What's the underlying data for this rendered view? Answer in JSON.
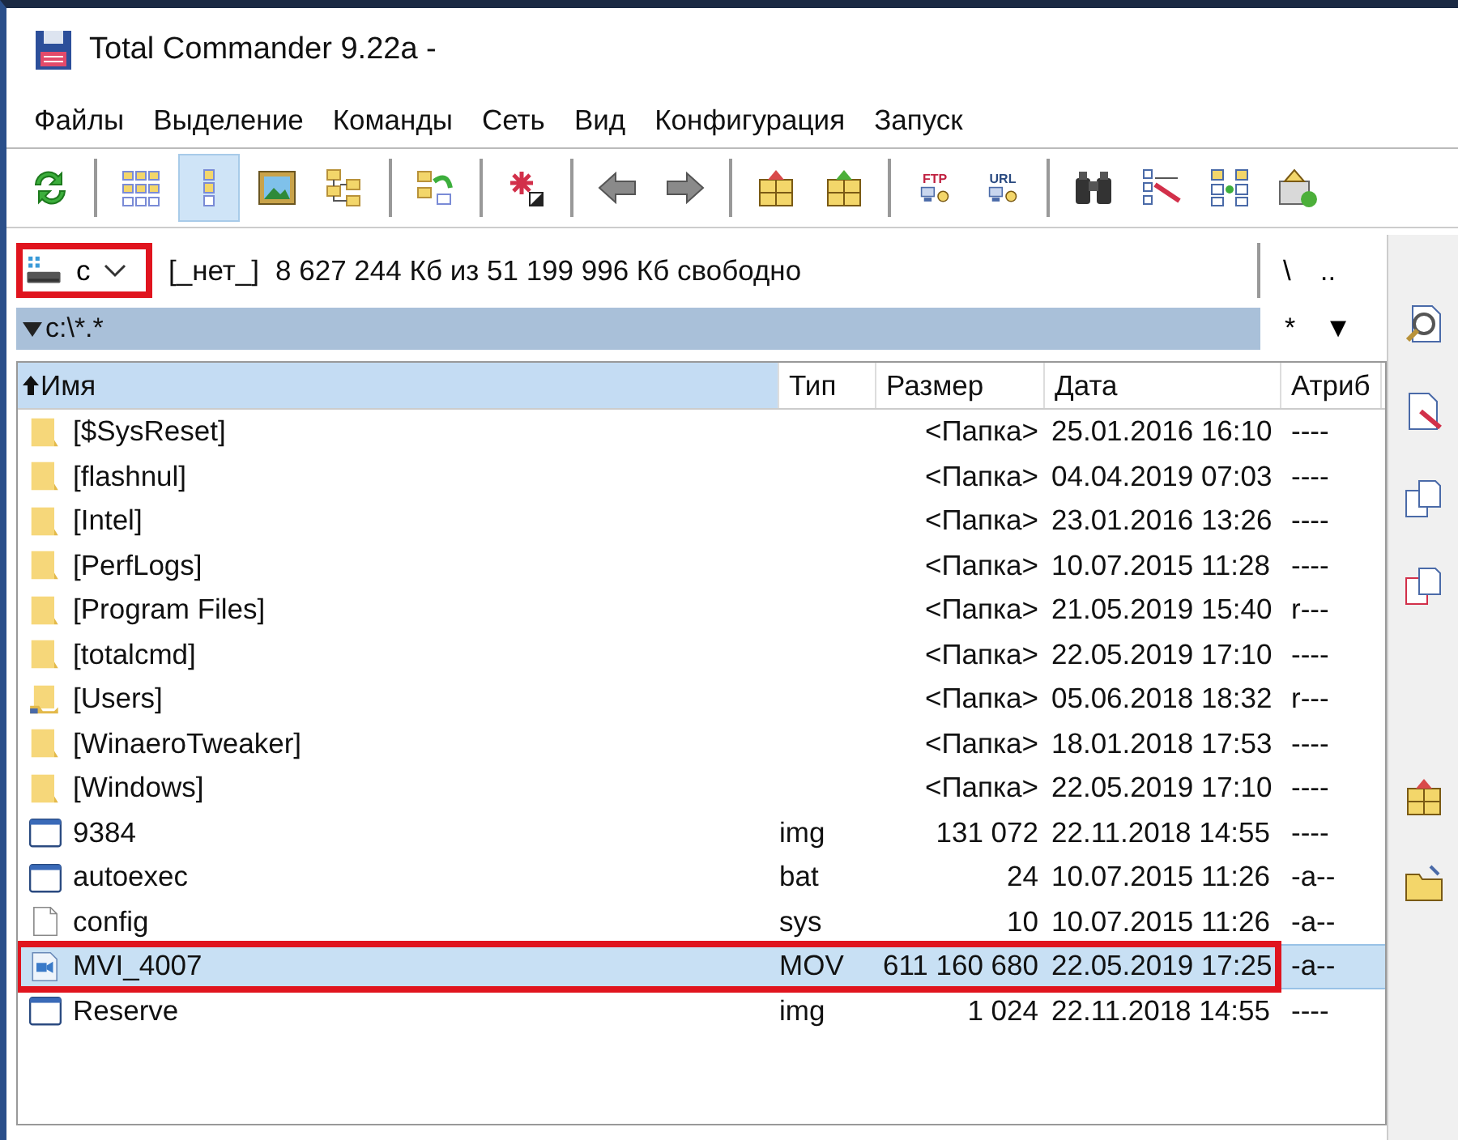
{
  "window": {
    "title": "Total Commander 9.22a -"
  },
  "menu": [
    {
      "label": "Файлы"
    },
    {
      "label": "Выделение"
    },
    {
      "label": "Команды"
    },
    {
      "label": "Сеть"
    },
    {
      "label": "Вид"
    },
    {
      "label": "Конфигурация"
    },
    {
      "label": "Запуск"
    }
  ],
  "toolbar": [
    {
      "kind": "refresh",
      "selected": false
    },
    {
      "kind": "sep"
    },
    {
      "kind": "brief",
      "selected": false
    },
    {
      "kind": "columns",
      "selected": true
    },
    {
      "kind": "thumbs",
      "selected": false
    },
    {
      "kind": "tree",
      "selected": false
    },
    {
      "kind": "sep"
    },
    {
      "kind": "compare",
      "selected": false
    },
    {
      "kind": "sep"
    },
    {
      "kind": "select",
      "selected": false
    },
    {
      "kind": "sep"
    },
    {
      "kind": "back",
      "selected": false
    },
    {
      "kind": "forward",
      "selected": false
    },
    {
      "kind": "sep"
    },
    {
      "kind": "pack",
      "selected": false
    },
    {
      "kind": "unpack",
      "selected": false
    },
    {
      "kind": "sep"
    },
    {
      "kind": "ftp",
      "label": "FTP",
      "selected": false
    },
    {
      "kind": "url",
      "label": "URL",
      "selected": false
    },
    {
      "kind": "sep"
    },
    {
      "kind": "find",
      "selected": false
    },
    {
      "kind": "rename",
      "selected": false
    },
    {
      "kind": "sync",
      "selected": false
    },
    {
      "kind": "network",
      "selected": false
    }
  ],
  "drive_bar": {
    "drive": "c",
    "annotated": true,
    "label": "[_нет_]",
    "free_space": "8 627 244 Кб из 51 199 996 Кб свободно",
    "buttons": [
      "\\",
      ".."
    ]
  },
  "path_bar": {
    "path": "c:\\*.*",
    "buttons": [
      "*",
      "▼"
    ]
  },
  "file_list": {
    "columns": [
      {
        "label": "Имя",
        "sorted": true
      },
      {
        "label": "Тип",
        "sorted": false
      },
      {
        "label": "Размер",
        "sorted": false
      },
      {
        "label": "Дата",
        "sorted": false
      },
      {
        "label": "Атриб",
        "sorted": false
      }
    ],
    "rows": [
      {
        "kind": "folder",
        "name": "[$SysReset]",
        "type": "",
        "size": "<Папка>",
        "date": "25.01.2016 16:10",
        "attr": "----",
        "selected": false,
        "annotated": false
      },
      {
        "kind": "folder",
        "name": "[flashnul]",
        "type": "",
        "size": "<Папка>",
        "date": "04.04.2019 07:03",
        "attr": "----",
        "selected": false,
        "annotated": false
      },
      {
        "kind": "folder",
        "name": "[Intel]",
        "type": "",
        "size": "<Папка>",
        "date": "23.01.2016 13:26",
        "attr": "----",
        "selected": false,
        "annotated": false
      },
      {
        "kind": "folder",
        "name": "[PerfLogs]",
        "type": "",
        "size": "<Папка>",
        "date": "10.07.2015 11:28",
        "attr": "----",
        "selected": false,
        "annotated": false
      },
      {
        "kind": "folder",
        "name": "[Program Files]",
        "type": "",
        "size": "<Папка>",
        "date": "21.05.2019 15:40",
        "attr": "r---",
        "selected": false,
        "annotated": false
      },
      {
        "kind": "folder",
        "name": "[totalcmd]",
        "type": "",
        "size": "<Папка>",
        "date": "22.05.2019 17:10",
        "attr": "----",
        "selected": false,
        "annotated": false
      },
      {
        "kind": "folder-link",
        "name": "[Users]",
        "type": "",
        "size": "<Папка>",
        "date": "05.06.2018 18:32",
        "attr": "r---",
        "selected": false,
        "annotated": false
      },
      {
        "kind": "folder",
        "name": "[WinaeroTweaker]",
        "type": "",
        "size": "<Папка>",
        "date": "18.01.2018 17:53",
        "attr": "----",
        "selected": false,
        "annotated": false
      },
      {
        "kind": "folder",
        "name": "[Windows]",
        "type": "",
        "size": "<Папка>",
        "date": "22.05.2019 17:10",
        "attr": "----",
        "selected": false,
        "annotated": false
      },
      {
        "kind": "window",
        "name": "9384",
        "type": "img",
        "size": "131 072",
        "date": "22.11.2018 14:55",
        "attr": "----",
        "selected": false,
        "annotated": false
      },
      {
        "kind": "window",
        "name": "autoexec",
        "type": "bat",
        "size": "24",
        "date": "10.07.2015 11:26",
        "attr": "-a--",
        "selected": false,
        "annotated": false
      },
      {
        "kind": "file",
        "name": "config",
        "type": "sys",
        "size": "10",
        "date": "10.07.2015 11:26",
        "attr": "-a--",
        "selected": false,
        "annotated": false
      },
      {
        "kind": "video",
        "name": "MVI_4007",
        "type": "MOV",
        "size": "611 160 680",
        "date": "22.05.2019 17:25",
        "attr": "-a--",
        "selected": true,
        "annotated": true
      },
      {
        "kind": "window",
        "name": "Reserve",
        "type": "img",
        "size": "1 024",
        "date": "22.11.2018 14:55",
        "attr": "----",
        "selected": false,
        "annotated": false
      }
    ]
  },
  "button_bar": [
    {
      "kind": "view"
    },
    {
      "kind": "edit"
    },
    {
      "kind": "copy"
    },
    {
      "kind": "move"
    },
    {
      "kind": "gap"
    },
    {
      "kind": "pack"
    },
    {
      "kind": "newfolder"
    }
  ]
}
